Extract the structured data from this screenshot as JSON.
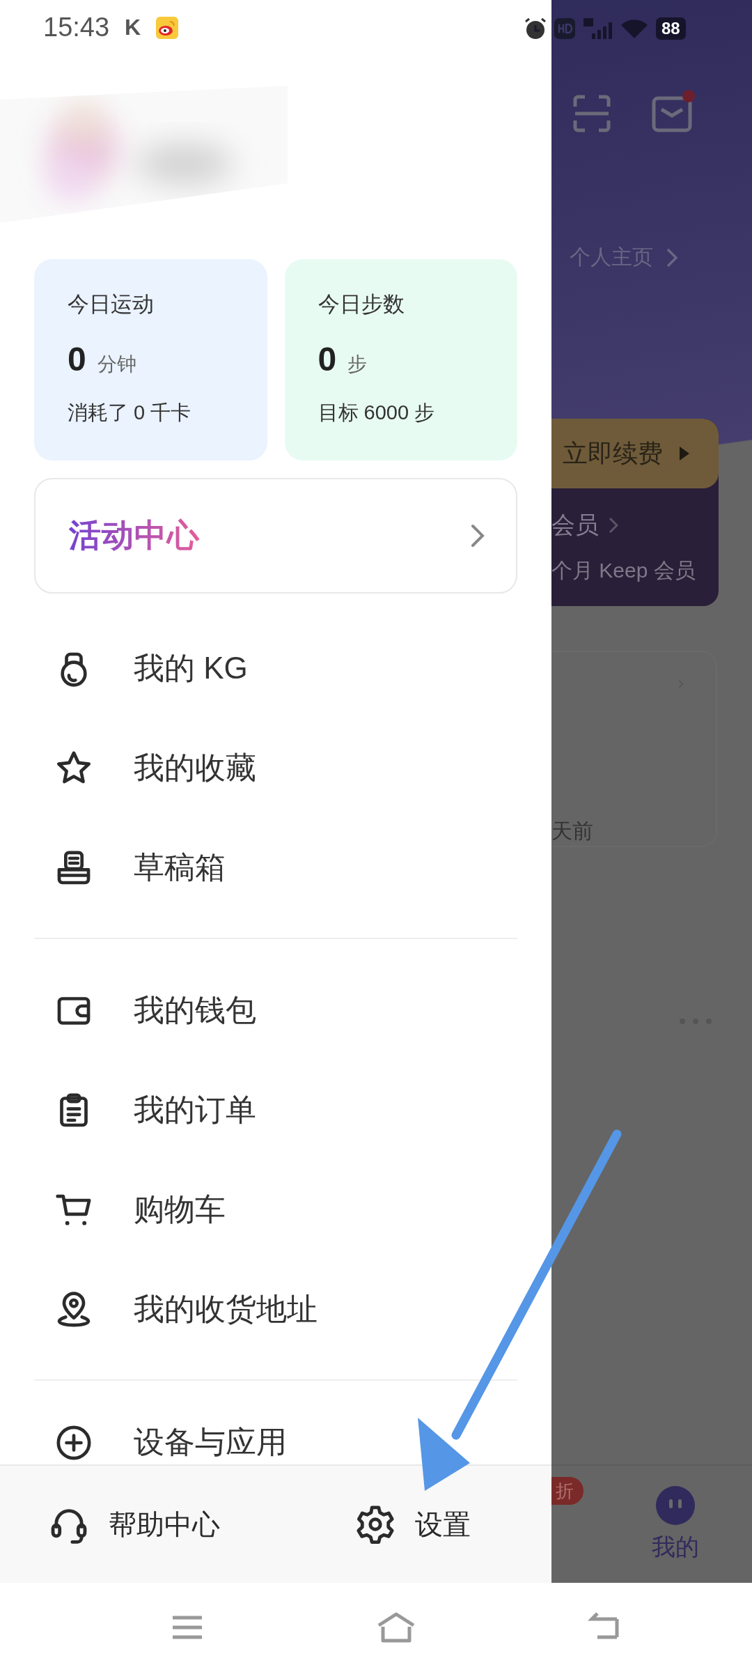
{
  "status_bar": {
    "time": "15:43",
    "notification_letter": "K",
    "battery": "88"
  },
  "stats": [
    {
      "title": "今日运动",
      "value": "0",
      "unit": "分钟",
      "note": "消耗了 0 千卡",
      "color": "#eaf3fe"
    },
    {
      "title": "今日步数",
      "value": "0",
      "unit": "步",
      "note": "目标 6000 步",
      "color": "#e8fbf3"
    }
  ],
  "activity_banner": {
    "title": "活动中心"
  },
  "menu_groups": [
    {
      "items": [
        {
          "kind": "kettlebell",
          "label": "我的 KG"
        },
        {
          "kind": "favorites",
          "label": "我的收藏"
        },
        {
          "kind": "drafts",
          "label": "草稿箱"
        }
      ]
    },
    {
      "items": [
        {
          "kind": "wallet",
          "label": "我的钱包"
        },
        {
          "kind": "orders",
          "label": "我的订单"
        },
        {
          "kind": "cart",
          "label": "购物车"
        },
        {
          "kind": "address",
          "label": "我的收货地址"
        }
      ]
    },
    {
      "items": [
        {
          "kind": "devices",
          "label": "设备与应用"
        }
      ]
    }
  ],
  "footer": [
    {
      "kind": "help",
      "label": "帮助中心"
    },
    {
      "kind": "settings",
      "label": "设置"
    }
  ],
  "background_page": {
    "profile_link": "个人主页",
    "renew_button": "立即续费",
    "membership_link": "会员",
    "membership_note": "个月 Keep 会员",
    "time_ago": "天前",
    "discount_badge": "折",
    "active_tab": "我的"
  }
}
